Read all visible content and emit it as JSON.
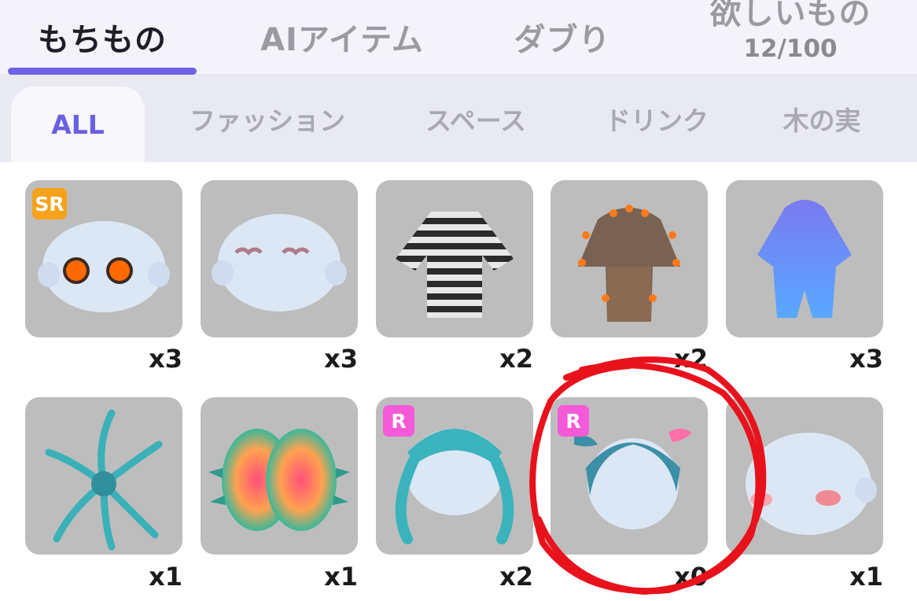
{
  "tabs": [
    {
      "label": "もちもの",
      "sub": ""
    },
    {
      "label": "AIアイテム",
      "sub": ""
    },
    {
      "label": "ダブり",
      "sub": ""
    },
    {
      "label": "欲しいもの",
      "sub": "12/100"
    }
  ],
  "categories": [
    "ALL",
    "ファッション",
    "スペース",
    "ドリンク",
    "木の実"
  ],
  "items": [
    {
      "count": "x3",
      "badge": "SR",
      "icon": "face-orange-eyes-icon"
    },
    {
      "count": "x3",
      "badge": "",
      "icon": "face-sleepy-icon"
    },
    {
      "count": "x2",
      "badge": "",
      "icon": "striped-sweater-icon"
    },
    {
      "count": "x2",
      "badge": "",
      "icon": "brown-spiky-cloak-icon"
    },
    {
      "count": "x3",
      "badge": "",
      "icon": "purple-slime-outfit-icon"
    },
    {
      "count": "x1",
      "badge": "",
      "icon": "seaweed-spider-icon"
    },
    {
      "count": "x1",
      "badge": "",
      "icon": "flytrap-mouth-icon"
    },
    {
      "count": "x2",
      "badge": "R",
      "icon": "braided-teal-hair-icon"
    },
    {
      "count": "x0",
      "badge": "R",
      "icon": "teal-pigtail-hair-icon"
    },
    {
      "count": "x1",
      "badge": "",
      "icon": "blush-face-icon"
    }
  ],
  "colors": {
    "accent": "#6f62e6",
    "sr_badge": "#f7a21b",
    "r_badge": "#f45ad8",
    "annotation": "#e8121c"
  }
}
